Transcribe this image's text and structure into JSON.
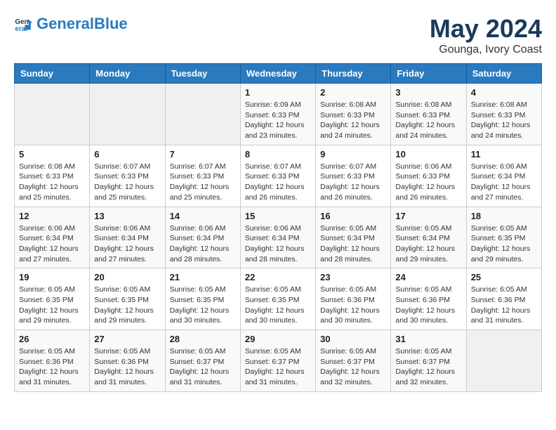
{
  "header": {
    "logo_general": "General",
    "logo_blue": "Blue",
    "title": "May 2024",
    "subtitle": "Gounga, Ivory Coast"
  },
  "weekdays": [
    "Sunday",
    "Monday",
    "Tuesday",
    "Wednesday",
    "Thursday",
    "Friday",
    "Saturday"
  ],
  "weeks": [
    [
      {
        "day": "",
        "info": ""
      },
      {
        "day": "",
        "info": ""
      },
      {
        "day": "",
        "info": ""
      },
      {
        "day": "1",
        "info": "Sunrise: 6:09 AM\nSunset: 6:33 PM\nDaylight: 12 hours\nand 23 minutes."
      },
      {
        "day": "2",
        "info": "Sunrise: 6:08 AM\nSunset: 6:33 PM\nDaylight: 12 hours\nand 24 minutes."
      },
      {
        "day": "3",
        "info": "Sunrise: 6:08 AM\nSunset: 6:33 PM\nDaylight: 12 hours\nand 24 minutes."
      },
      {
        "day": "4",
        "info": "Sunrise: 6:08 AM\nSunset: 6:33 PM\nDaylight: 12 hours\nand 24 minutes."
      }
    ],
    [
      {
        "day": "5",
        "info": "Sunrise: 6:08 AM\nSunset: 6:33 PM\nDaylight: 12 hours\nand 25 minutes."
      },
      {
        "day": "6",
        "info": "Sunrise: 6:07 AM\nSunset: 6:33 PM\nDaylight: 12 hours\nand 25 minutes."
      },
      {
        "day": "7",
        "info": "Sunrise: 6:07 AM\nSunset: 6:33 PM\nDaylight: 12 hours\nand 25 minutes."
      },
      {
        "day": "8",
        "info": "Sunrise: 6:07 AM\nSunset: 6:33 PM\nDaylight: 12 hours\nand 26 minutes."
      },
      {
        "day": "9",
        "info": "Sunrise: 6:07 AM\nSunset: 6:33 PM\nDaylight: 12 hours\nand 26 minutes."
      },
      {
        "day": "10",
        "info": "Sunrise: 6:06 AM\nSunset: 6:33 PM\nDaylight: 12 hours\nand 26 minutes."
      },
      {
        "day": "11",
        "info": "Sunrise: 6:06 AM\nSunset: 6:34 PM\nDaylight: 12 hours\nand 27 minutes."
      }
    ],
    [
      {
        "day": "12",
        "info": "Sunrise: 6:06 AM\nSunset: 6:34 PM\nDaylight: 12 hours\nand 27 minutes."
      },
      {
        "day": "13",
        "info": "Sunrise: 6:06 AM\nSunset: 6:34 PM\nDaylight: 12 hours\nand 27 minutes."
      },
      {
        "day": "14",
        "info": "Sunrise: 6:06 AM\nSunset: 6:34 PM\nDaylight: 12 hours\nand 28 minutes."
      },
      {
        "day": "15",
        "info": "Sunrise: 6:06 AM\nSunset: 6:34 PM\nDaylight: 12 hours\nand 28 minutes."
      },
      {
        "day": "16",
        "info": "Sunrise: 6:05 AM\nSunset: 6:34 PM\nDaylight: 12 hours\nand 28 minutes."
      },
      {
        "day": "17",
        "info": "Sunrise: 6:05 AM\nSunset: 6:34 PM\nDaylight: 12 hours\nand 29 minutes."
      },
      {
        "day": "18",
        "info": "Sunrise: 6:05 AM\nSunset: 6:35 PM\nDaylight: 12 hours\nand 29 minutes."
      }
    ],
    [
      {
        "day": "19",
        "info": "Sunrise: 6:05 AM\nSunset: 6:35 PM\nDaylight: 12 hours\nand 29 minutes."
      },
      {
        "day": "20",
        "info": "Sunrise: 6:05 AM\nSunset: 6:35 PM\nDaylight: 12 hours\nand 29 minutes."
      },
      {
        "day": "21",
        "info": "Sunrise: 6:05 AM\nSunset: 6:35 PM\nDaylight: 12 hours\nand 30 minutes."
      },
      {
        "day": "22",
        "info": "Sunrise: 6:05 AM\nSunset: 6:35 PM\nDaylight: 12 hours\nand 30 minutes."
      },
      {
        "day": "23",
        "info": "Sunrise: 6:05 AM\nSunset: 6:36 PM\nDaylight: 12 hours\nand 30 minutes."
      },
      {
        "day": "24",
        "info": "Sunrise: 6:05 AM\nSunset: 6:36 PM\nDaylight: 12 hours\nand 30 minutes."
      },
      {
        "day": "25",
        "info": "Sunrise: 6:05 AM\nSunset: 6:36 PM\nDaylight: 12 hours\nand 31 minutes."
      }
    ],
    [
      {
        "day": "26",
        "info": "Sunrise: 6:05 AM\nSunset: 6:36 PM\nDaylight: 12 hours\nand 31 minutes."
      },
      {
        "day": "27",
        "info": "Sunrise: 6:05 AM\nSunset: 6:36 PM\nDaylight: 12 hours\nand 31 minutes."
      },
      {
        "day": "28",
        "info": "Sunrise: 6:05 AM\nSunset: 6:37 PM\nDaylight: 12 hours\nand 31 minutes."
      },
      {
        "day": "29",
        "info": "Sunrise: 6:05 AM\nSunset: 6:37 PM\nDaylight: 12 hours\nand 31 minutes."
      },
      {
        "day": "30",
        "info": "Sunrise: 6:05 AM\nSunset: 6:37 PM\nDaylight: 12 hours\nand 32 minutes."
      },
      {
        "day": "31",
        "info": "Sunrise: 6:05 AM\nSunset: 6:37 PM\nDaylight: 12 hours\nand 32 minutes."
      },
      {
        "day": "",
        "info": ""
      }
    ]
  ]
}
